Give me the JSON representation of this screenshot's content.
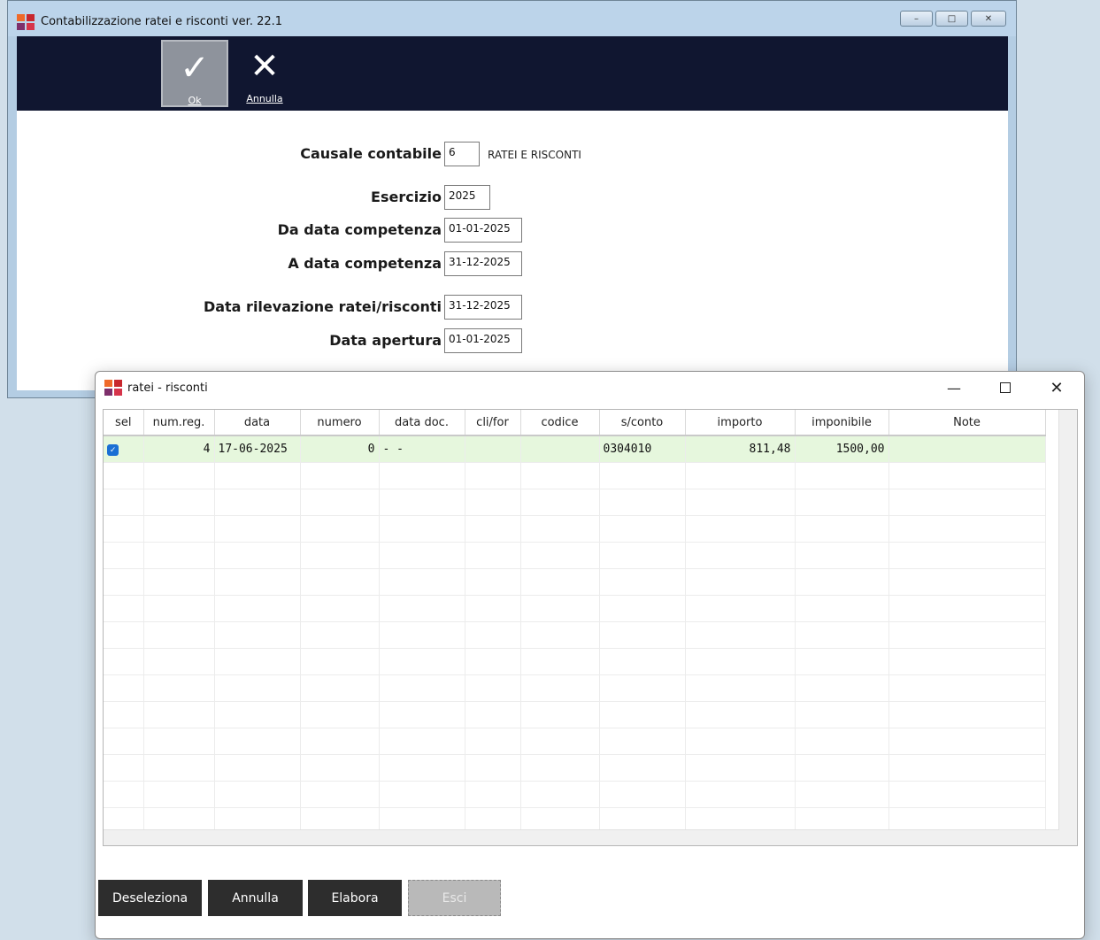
{
  "main_window": {
    "title": "Contabilizzazione ratei e risconti  ver. 22.1",
    "controls": {
      "minimize": "–",
      "maximize": "□",
      "close": "✕"
    },
    "toolbar": {
      "ok_label": "Ok",
      "ok_icon": "✓",
      "annulla_label": "Annulla",
      "annulla_icon": "✕"
    },
    "form": {
      "causale_label": "Causale contabile",
      "causale_value": "6",
      "causale_desc": "RATEI E RISCONTI",
      "esercizio_label": "Esercizio",
      "esercizio_value": "2025",
      "da_data_label": "Da data competenza",
      "da_data_value": "01-01-2025",
      "a_data_label": "A data competenza",
      "a_data_value": "31-12-2025",
      "rilevazione_label": "Data rilevazione ratei/risconti",
      "rilevazione_value": "31-12-2025",
      "apertura_label": "Data apertura",
      "apertura_value": "01-01-2025"
    }
  },
  "dialog": {
    "title": "ratei - risconti",
    "controls": {
      "minimize": "—",
      "close": "✕"
    },
    "grid": {
      "columns": [
        "sel",
        "num.reg.",
        "data",
        "numero",
        "data doc.",
        "cli/for",
        "codice",
        "s/conto",
        "importo",
        "imponibile",
        "Note"
      ],
      "rows": [
        {
          "sel": true,
          "num_reg": "4",
          "data": "17-06-2025",
          "numero": "0",
          "data_doc": "- -",
          "cli_for": "",
          "codice": "",
          "s_conto": "0304010",
          "importo": "811,48",
          "imponibile": "1500,00",
          "note": ""
        }
      ]
    },
    "buttons": {
      "deseleziona": "Deseleziona",
      "annulla": "Annulla",
      "elabora": "Elabora",
      "esci": "Esci"
    }
  },
  "colors": {
    "toolbar_bg": "#101630",
    "selected_row_bg": "#e6f7dd",
    "button_bg": "#2d2d2d",
    "checkbox": "#1a6fd4",
    "app_icon": [
      "#ef6a2a",
      "#c8272d",
      "#7e2f6b",
      "#d6344a"
    ]
  }
}
